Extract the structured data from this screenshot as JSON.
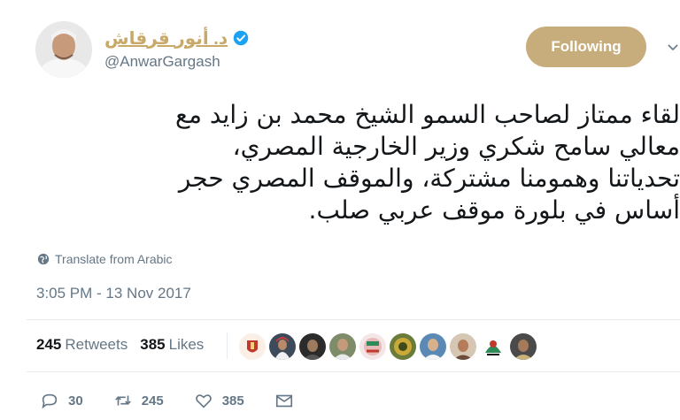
{
  "user": {
    "display_name": "د. أنور قرقاش",
    "handle": "@AnwarGargash",
    "verified": true,
    "name_color": "#c8a96a"
  },
  "follow_button": {
    "label": "Following",
    "color": "#c8ad7c"
  },
  "tweet": {
    "lines": [
      "لقاء ممتاز لصاحب السمو الشيخ محمد بن زايد مع",
      "معالي سامح شكري وزير الخارجية المصري،",
      "تحدياتنا وهمومنا مشتركة، والموقف المصري حجر",
      "أساس في بلورة موقف عربي صلب."
    ],
    "translate_label": "Translate from Arabic",
    "timestamp": "3:05 PM - 13 Nov 2017"
  },
  "stats": {
    "retweets_count": "245",
    "retweets_label": "Retweets",
    "likes_count": "385",
    "likes_label": "Likes"
  },
  "actions": {
    "reply_count": "30",
    "retweet_count": "245",
    "like_count": "385"
  },
  "icons": [
    "verified-badge-icon",
    "chevron-down-icon",
    "globe-icon",
    "reply-icon",
    "retweet-icon",
    "heart-icon",
    "message-icon"
  ]
}
